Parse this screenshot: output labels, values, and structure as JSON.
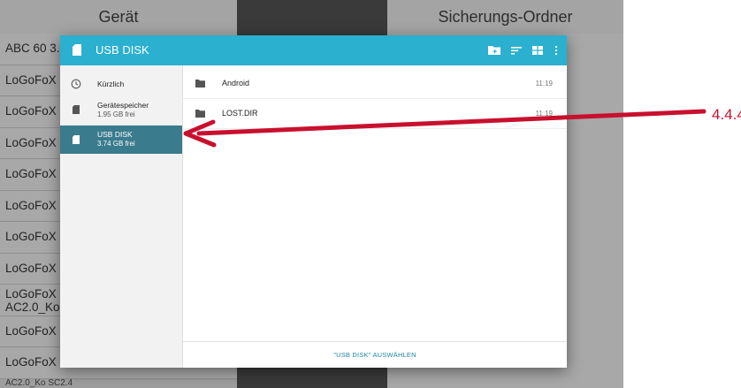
{
  "background": {
    "col_left_title": "Gerät",
    "col_right_title": "Sicherungs-Ordner",
    "rows": [
      "ABC 60 3.",
      "LoGoFoX",
      "LoGoFoX",
      "LoGoFoX",
      "LoGoFoX",
      "LoGoFoX",
      "LoGoFoX",
      "LoGoFoX",
      "LoGoFoX",
      "AC2.0_Ko",
      "LoGoFoX",
      "LoGoFoX"
    ],
    "bottom_text": "AC2.0_Ko SC2.4"
  },
  "dialog": {
    "title": "USB DISK",
    "toolbar_icons": [
      "new-folder-icon",
      "sort-icon",
      "grid-view-icon",
      "more-vert-icon"
    ],
    "nav": [
      {
        "icon": "clock-icon",
        "label": "Kürzlich",
        "sub": ""
      },
      {
        "icon": "sd-card-icon",
        "label": "Gerätespeicher",
        "sub": "1.95 GB frei"
      },
      {
        "icon": "sd-card-icon",
        "label": "USB DISK",
        "sub": "3.74 GB frei",
        "selected": true
      }
    ],
    "files": [
      {
        "name": "Android",
        "time": "11:19"
      },
      {
        "name": "LOST.DIR",
        "time": "11:19"
      }
    ],
    "select_button": "\"USB DISK\" AUSWÄHLEN"
  },
  "annotation": {
    "label": "4.4.4",
    "color": "#c8102e"
  },
  "colors": {
    "accent": "#2bb0cf",
    "selected_nav": "#3a7b8d",
    "select_button_text": "#1d87a3"
  }
}
